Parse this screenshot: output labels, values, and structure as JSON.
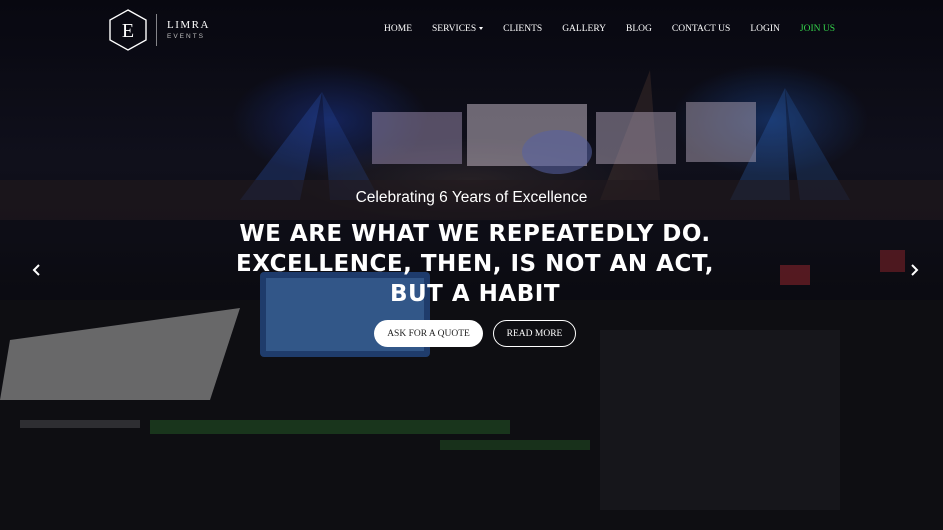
{
  "brand": {
    "name": "LIMRA",
    "sub": "EVENTS",
    "monogram": "E"
  },
  "nav": {
    "items": [
      {
        "label": "HOME"
      },
      {
        "label": "SERVICES"
      },
      {
        "label": "CLIENTS"
      },
      {
        "label": "GALLERY"
      },
      {
        "label": "BLOG"
      },
      {
        "label": "CONTACT US"
      },
      {
        "label": "LOGIN"
      },
      {
        "label": "JOIN US"
      }
    ]
  },
  "hero": {
    "tagline": "Celebrating 6 Years of Excellence",
    "headline": "WE ARE WHAT WE REPEATEDLY DO. EXCELLENCE, THEN, IS NOT AN ACT, BUT A HABIT",
    "primary_button": "ASK FOR A QUOTE",
    "secondary_button": "READ MORE"
  },
  "icons": {
    "prev": "chevron-left-icon",
    "next": "chevron-right-icon",
    "dropdown": "caret-down-icon"
  },
  "colors": {
    "join_accent": "#34d44a",
    "text": "#ffffff",
    "background": "#07070c"
  }
}
